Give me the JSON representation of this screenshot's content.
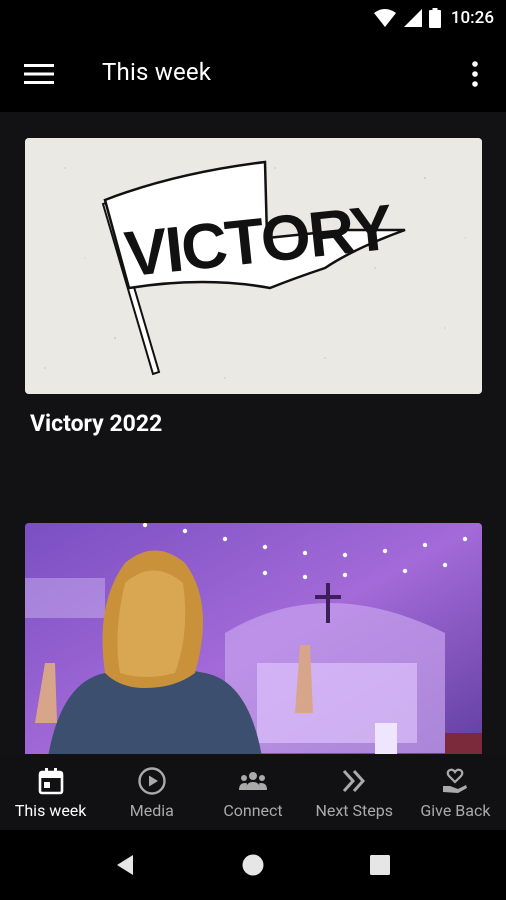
{
  "status_bar": {
    "time": "10:26",
    "icons": [
      "wifi-icon",
      "cellular-signal-icon",
      "battery-icon"
    ]
  },
  "app_bar": {
    "title": "This week",
    "menu_icon": "hamburger-menu-icon",
    "more_icon": "more-vertical-icon"
  },
  "cards": [
    {
      "title": "Victory 2022",
      "image": "victory-flag-banner",
      "image_text": "VICTORY"
    },
    {
      "title": "",
      "image": "worship-service-photo"
    }
  ],
  "bottom_nav": {
    "items": [
      {
        "label": "This week",
        "icon": "calendar-icon",
        "active": true
      },
      {
        "label": "Media",
        "icon": "play-circle-icon",
        "active": false
      },
      {
        "label": "Connect",
        "icon": "group-icon",
        "active": false
      },
      {
        "label": "Next Steps",
        "icon": "double-chevron-right-icon",
        "active": false
      },
      {
        "label": "Give Back",
        "icon": "heart-hand-icon",
        "active": false
      }
    ]
  },
  "colors": {
    "background": "#121214",
    "app_bar": "#000000",
    "active": "#ffffff",
    "inactive": "#aaaaaa"
  }
}
